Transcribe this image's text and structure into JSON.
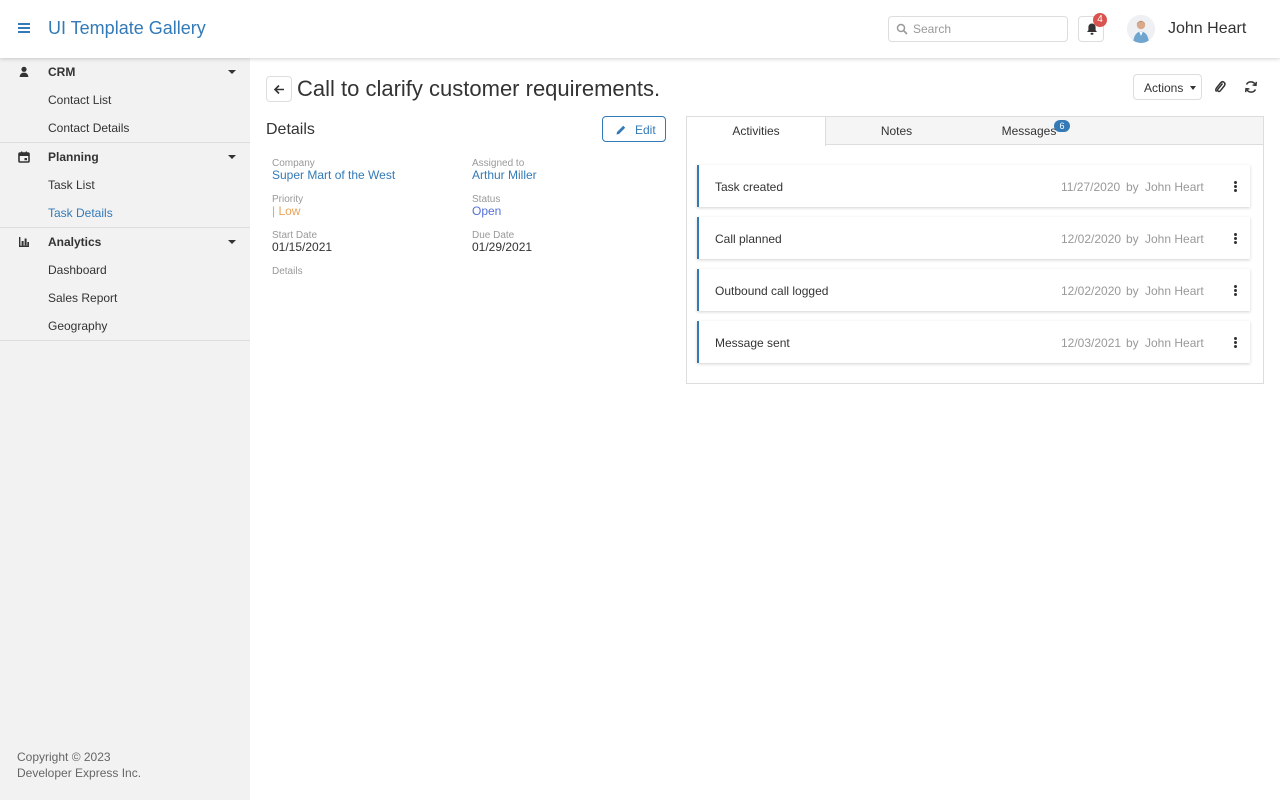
{
  "header": {
    "app_title": "UI Template Gallery",
    "search_placeholder": "Search",
    "notifications_count": "4",
    "user_name": "John Heart"
  },
  "sidebar": {
    "groups": [
      {
        "label": "CRM",
        "icon": "user-icon",
        "items": [
          {
            "label": "Contact List",
            "active": false
          },
          {
            "label": "Contact Details",
            "active": false
          }
        ]
      },
      {
        "label": "Planning",
        "icon": "calendar-icon",
        "items": [
          {
            "label": "Task List",
            "active": false
          },
          {
            "label": "Task Details",
            "active": true
          }
        ]
      },
      {
        "label": "Analytics",
        "icon": "chart-icon",
        "items": [
          {
            "label": "Dashboard",
            "active": false
          },
          {
            "label": "Sales Report",
            "active": false
          },
          {
            "label": "Geography",
            "active": false
          }
        ]
      }
    ],
    "copyright_line1": "Copyright © 2023",
    "copyright_line2": "Developer Express Inc."
  },
  "page": {
    "title": "Call to clarify customer requirements.",
    "actions_label": "Actions"
  },
  "details": {
    "title": "Details",
    "edit_label": "Edit",
    "company_label": "Company",
    "company_value": "Super Mart of the West",
    "assigned_label": "Assigned to",
    "assigned_value": "Arthur Miller",
    "priority_label": "Priority",
    "priority_value": "| Low",
    "status_label": "Status",
    "status_value": "Open",
    "start_label": "Start Date",
    "start_value": "01/15/2021",
    "due_label": "Due Date",
    "due_value": "01/29/2021",
    "details_label": "Details"
  },
  "tabs": [
    {
      "label": "Activities",
      "active": true
    },
    {
      "label": "Notes",
      "active": false
    },
    {
      "label": "Messages",
      "active": false,
      "badge": "6"
    }
  ],
  "activities": [
    {
      "name": "Task created",
      "date": "11/27/2020",
      "by": "by",
      "user": "John Heart"
    },
    {
      "name": "Call planned",
      "date": "12/02/2020",
      "by": "by",
      "user": "John Heart"
    },
    {
      "name": "Outbound call logged",
      "date": "12/02/2020",
      "by": "by",
      "user": "John Heart"
    },
    {
      "name": "Message sent",
      "date": "12/03/2021",
      "by": "by",
      "user": "John Heart"
    }
  ],
  "colors": {
    "accent": "#337ab7",
    "badge_red": "#d9534f",
    "priority_low": "#e9a35a",
    "status_open": "#5470d8"
  }
}
